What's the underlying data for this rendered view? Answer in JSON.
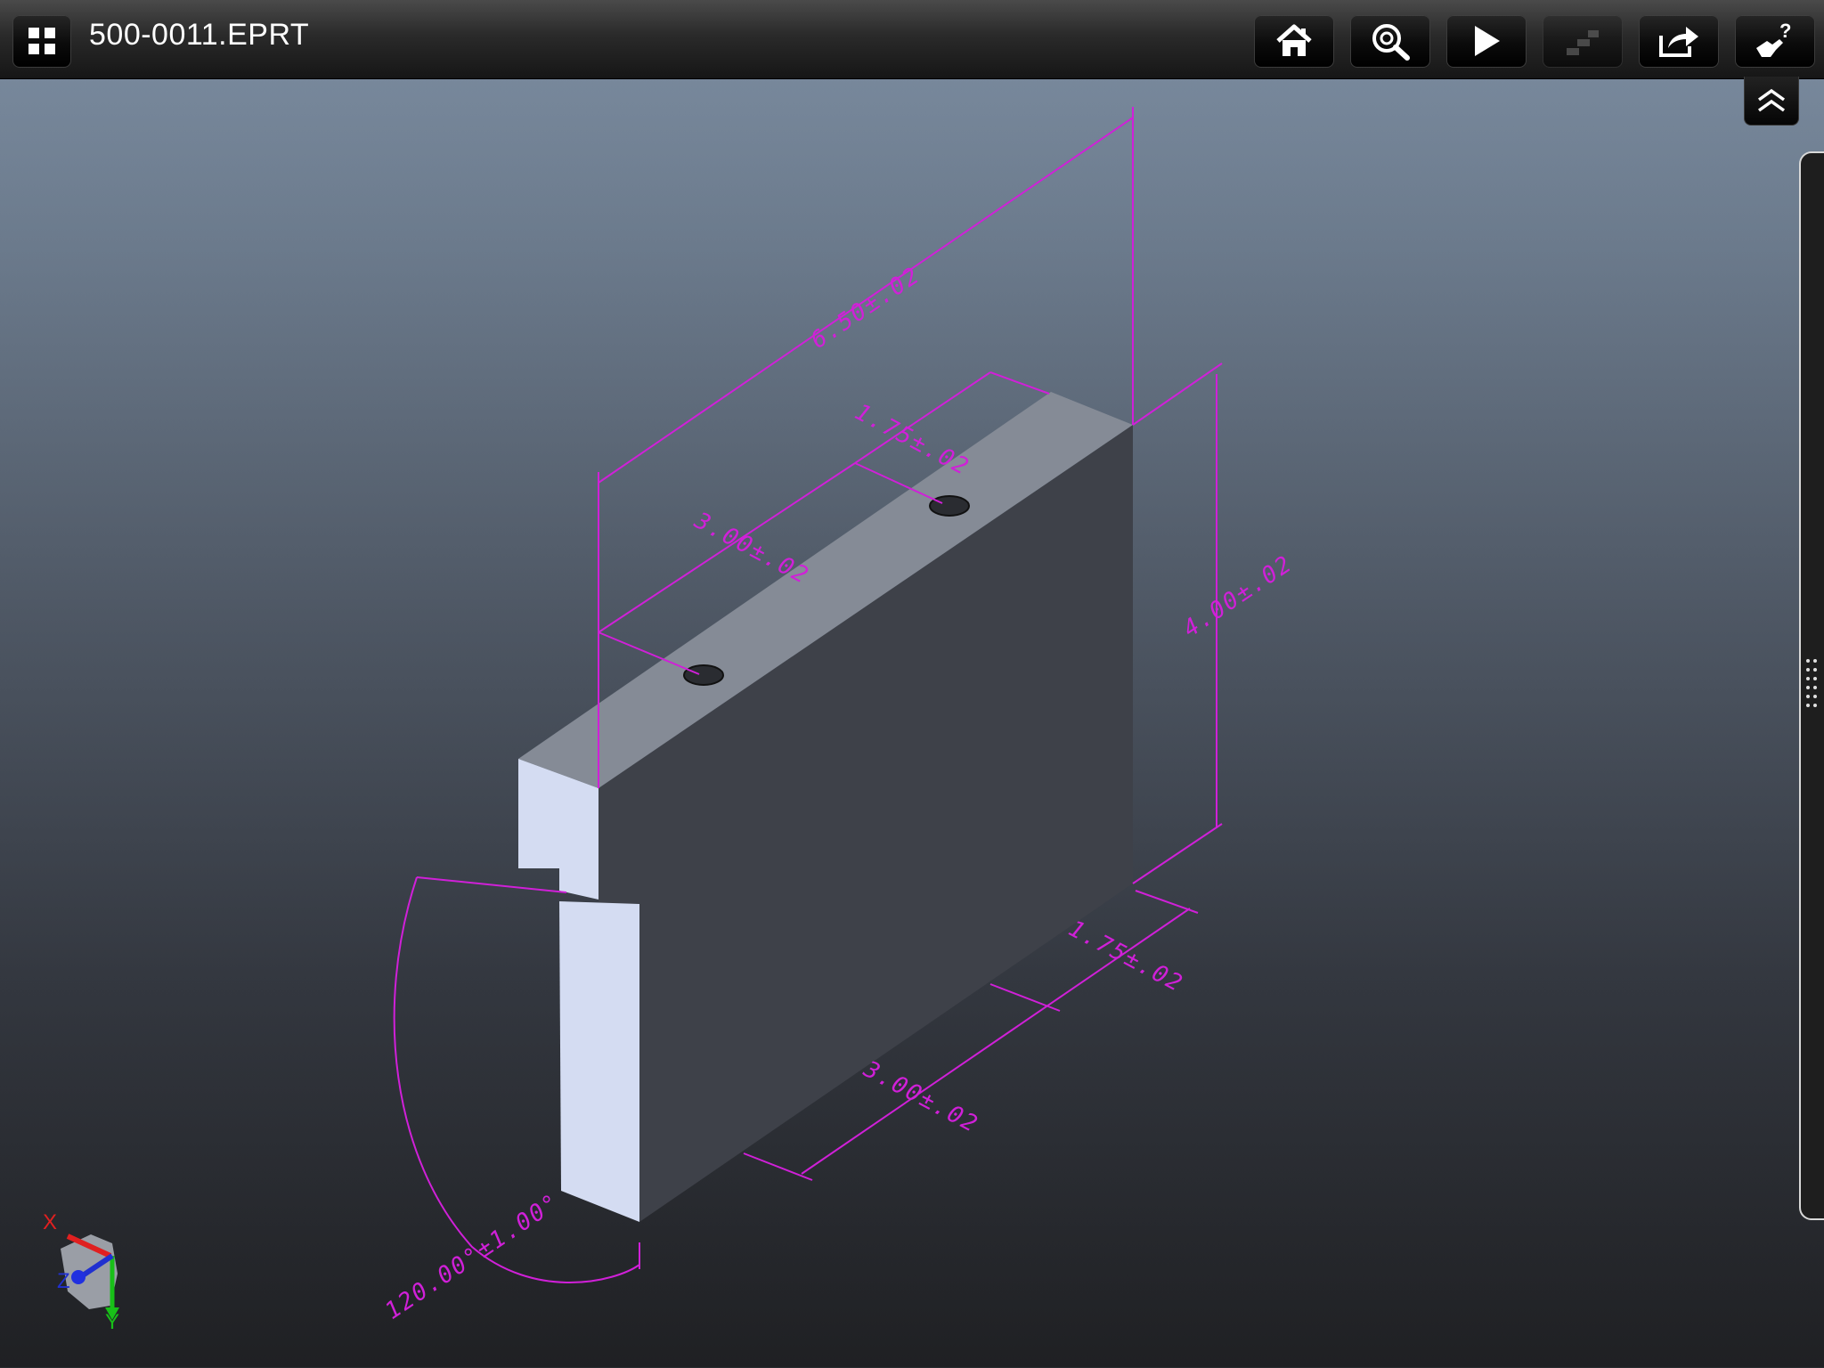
{
  "window": {
    "title": "500-0011.EPRT"
  },
  "toolbar": {
    "buttons": [
      {
        "id": "apps",
        "icon": "grid-icon"
      },
      {
        "id": "home",
        "icon": "home-icon"
      },
      {
        "id": "zoom",
        "icon": "zoom-fit-icon"
      },
      {
        "id": "play",
        "icon": "play-icon"
      },
      {
        "id": "steps",
        "icon": "steps-icon",
        "enabled": false
      },
      {
        "id": "share",
        "icon": "share-icon"
      },
      {
        "id": "help",
        "icon": "help-gesture-icon"
      }
    ],
    "collapse_icon": "double-chevron-up-icon"
  },
  "model": {
    "dimensions": {
      "overall_length": "6.50±.02",
      "top_hole_spacing": "1.75±.02",
      "top_hole_offset": "3.00±.02",
      "height": "4.00±.02",
      "bottom_spacing": "1.75±.02",
      "bottom_offset": "3.00±.02",
      "angle": "120.00°±1.00°"
    },
    "annotation_color": "#d020d8",
    "axes": {
      "x": "X",
      "y": "Y",
      "z": "Z"
    }
  }
}
